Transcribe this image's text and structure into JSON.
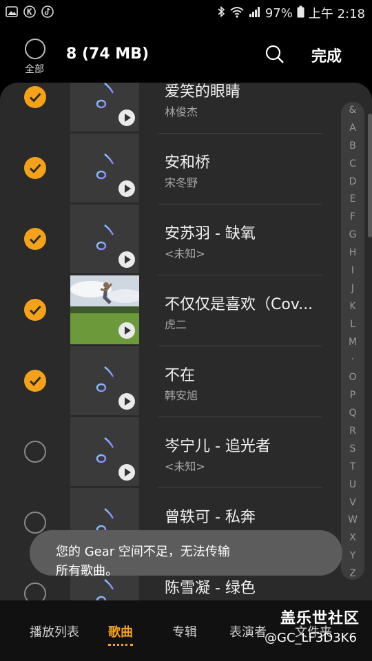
{
  "status_bar": {
    "battery": "97%",
    "time": "上午 2:18",
    "left_icons": [
      "gallery-icon",
      "k-app-icon",
      "tiktok-icon"
    ],
    "right_icons": [
      "bluetooth-icon",
      "wifi-icon",
      "signal-icon",
      "battery-icon"
    ]
  },
  "header": {
    "select_all_label": "全部",
    "count": "8 (74 MB)",
    "done_label": "完成"
  },
  "songs": [
    {
      "title": "爱笑的眼睛",
      "artist": "林俊杰",
      "checked": true,
      "thumb": "note"
    },
    {
      "title": "安和桥",
      "artist": "宋冬野",
      "checked": true,
      "thumb": "note"
    },
    {
      "title": "安苏羽 - 缺氧",
      "artist": "<未知>",
      "checked": true,
      "thumb": "note"
    },
    {
      "title": "不仅仅是喜欢（Cov...",
      "artist": "虎二",
      "checked": true,
      "thumb": "photo"
    },
    {
      "title": "不在",
      "artist": "韩安旭",
      "checked": true,
      "thumb": "note"
    },
    {
      "title": "岑宁儿 - 追光者",
      "artist": "<未知>",
      "checked": false,
      "thumb": "note"
    },
    {
      "title": "曾轶可 - 私奔",
      "artist": "<未知>",
      "checked": false,
      "thumb": "note"
    },
    {
      "title": "陈雪凝 - 绿色",
      "artist": "",
      "checked": false,
      "thumb": "note"
    }
  ],
  "index_letters": [
    "&",
    "A",
    "B",
    "C",
    "D",
    "E",
    "F",
    "G",
    "H",
    "I",
    "J",
    "K",
    "L",
    "M",
    "·",
    "O",
    "P",
    "Q",
    "R",
    "S",
    "T",
    "U",
    "V",
    "W",
    "X",
    "Y",
    "Z"
  ],
  "toast": {
    "line1": "您的 Gear 空间不足，无法传输",
    "line2": "所有歌曲。"
  },
  "tabs": [
    "播放列表",
    "歌曲",
    "专辑",
    "表演者",
    "文件夹"
  ],
  "active_tab": "歌曲",
  "watermark": {
    "logo": "盖乐世社区",
    "user": "@GC_LF3D3K6"
  },
  "colors": {
    "accent": "#f5a21b",
    "panel": "#2a2a2a",
    "background": "#000000"
  }
}
